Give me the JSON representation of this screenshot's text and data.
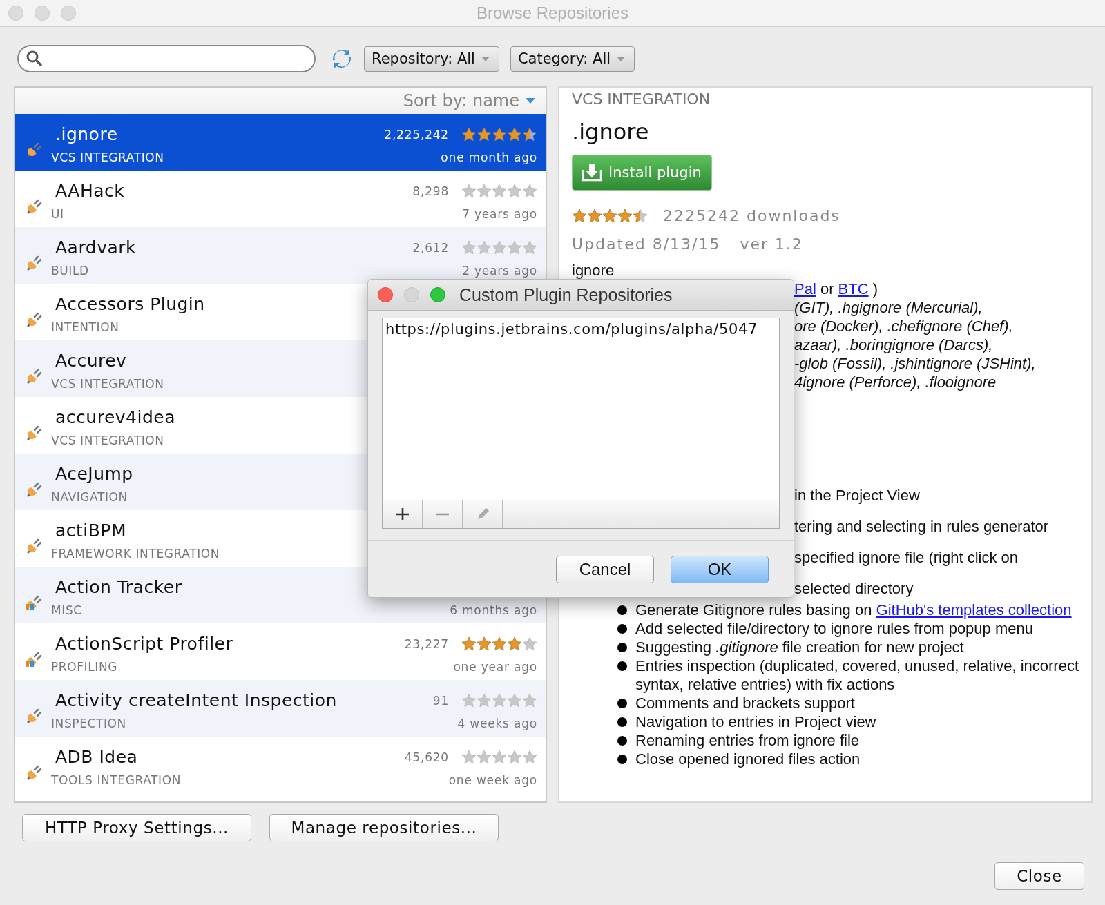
{
  "window": {
    "title": "Browse Repositories"
  },
  "toolbar": {
    "repository_filter": "Repository: All",
    "category_filter": "Category: All"
  },
  "plugin_list": {
    "sort_label": "Sort by: name",
    "items": [
      {
        "name": ".ignore",
        "category": "VCS INTEGRATION",
        "downloads": "2,225,242",
        "stars": 4.5,
        "updated": "one month ago",
        "selected": true,
        "kind": "plugin"
      },
      {
        "name": "AAHack",
        "category": "UI",
        "downloads": "8,298",
        "stars": 0,
        "updated": "7 years ago",
        "selected": false,
        "kind": "plugin"
      },
      {
        "name": "Aardvark",
        "category": "BUILD",
        "downloads": "2,612",
        "stars": 0,
        "updated": "2 years ago",
        "selected": false,
        "kind": "plugin"
      },
      {
        "name": "Accessors Plugin",
        "category": "INTENTION",
        "selected": false,
        "kind": "plugin"
      },
      {
        "name": "Accurev",
        "category": "VCS INTEGRATION",
        "selected": false,
        "kind": "plugin"
      },
      {
        "name": "accurev4idea",
        "category": "VCS INTEGRATION",
        "selected": false,
        "kind": "plugin"
      },
      {
        "name": "AceJump",
        "category": "NAVIGATION",
        "selected": false,
        "kind": "plugin"
      },
      {
        "name": "actiBPM",
        "category": "FRAMEWORK INTEGRATION",
        "selected": false,
        "kind": "plugin"
      },
      {
        "name": "Action Tracker",
        "category": "MISC",
        "updated": "6 months ago",
        "selected": false,
        "kind": "jetbrains"
      },
      {
        "name": "ActionScript Profiler",
        "category": "PROFILING",
        "downloads": "23,227",
        "stars": 4,
        "updated": "one year ago",
        "selected": false,
        "kind": "jetbrains"
      },
      {
        "name": "Activity createIntent Inspection",
        "category": "INSPECTION",
        "downloads": "91",
        "stars": 0,
        "updated": "4 weeks ago",
        "selected": false,
        "kind": "plugin"
      },
      {
        "name": "ADB Idea",
        "category": "TOOLS INTEGRATION",
        "downloads": "45,620",
        "stars": 0,
        "updated": "one week ago",
        "selected": false,
        "kind": "plugin"
      }
    ]
  },
  "details": {
    "category": "VCS INTEGRATION",
    "name": ".ignore",
    "install_button": "Install plugin",
    "stars": 4.5,
    "downloads": "2225242 downloads",
    "updated": "Updated 8/13/15",
    "version": "ver 1.2",
    "intro": "ignore",
    "links_line": [
      {
        "text": "Pal",
        "link": true
      },
      {
        "text": " or ",
        "link": false
      },
      {
        "text": "BTC",
        "link": true
      },
      {
        "text": " )",
        "link": false
      }
    ],
    "fragments_upper": [
      "(GIT), .hgignore (Mercurial),",
      "ore (Docker), .chefignore (Chef),",
      "azaar), .boringignore (Darcs),",
      "-glob (Fossil), .jshintignore (JSHint),",
      "4ignore (Perforce), .flooignore"
    ],
    "fragments_lower": [
      "in the Project View",
      "tering and selecting in rules generator",
      "specified ignore file (right click on",
      "selected directory"
    ],
    "bullets": [
      {
        "text": "Generate Gitignore rules basing on ",
        "link": "GitHub's templates collection"
      },
      {
        "text": "Add selected file/directory to ignore rules from popup menu"
      },
      {
        "text": "Suggesting *.gitignore* file creation for new project"
      },
      {
        "text": "Entries inspection (duplicated, covered, unused, relative, incorrect syntax, relative entries) with fix actions"
      },
      {
        "text": "Comments and brackets support"
      },
      {
        "text": "Navigation to entries in Project view"
      },
      {
        "text": "Renaming entries from ignore file"
      },
      {
        "text": "Close opened ignored files action"
      }
    ]
  },
  "buttons": [
    "HTTP Proxy Settings...",
    "Manage repositories..."
  ],
  "close_button": "Close",
  "dialog": {
    "title": "Custom Plugin Repositories",
    "repositories": [
      {
        "url": "https://plugins.jetbrains.com/plugins/alpha/5047",
        "selected": false
      }
    ],
    "cancel": "Cancel",
    "ok": "OK"
  }
}
